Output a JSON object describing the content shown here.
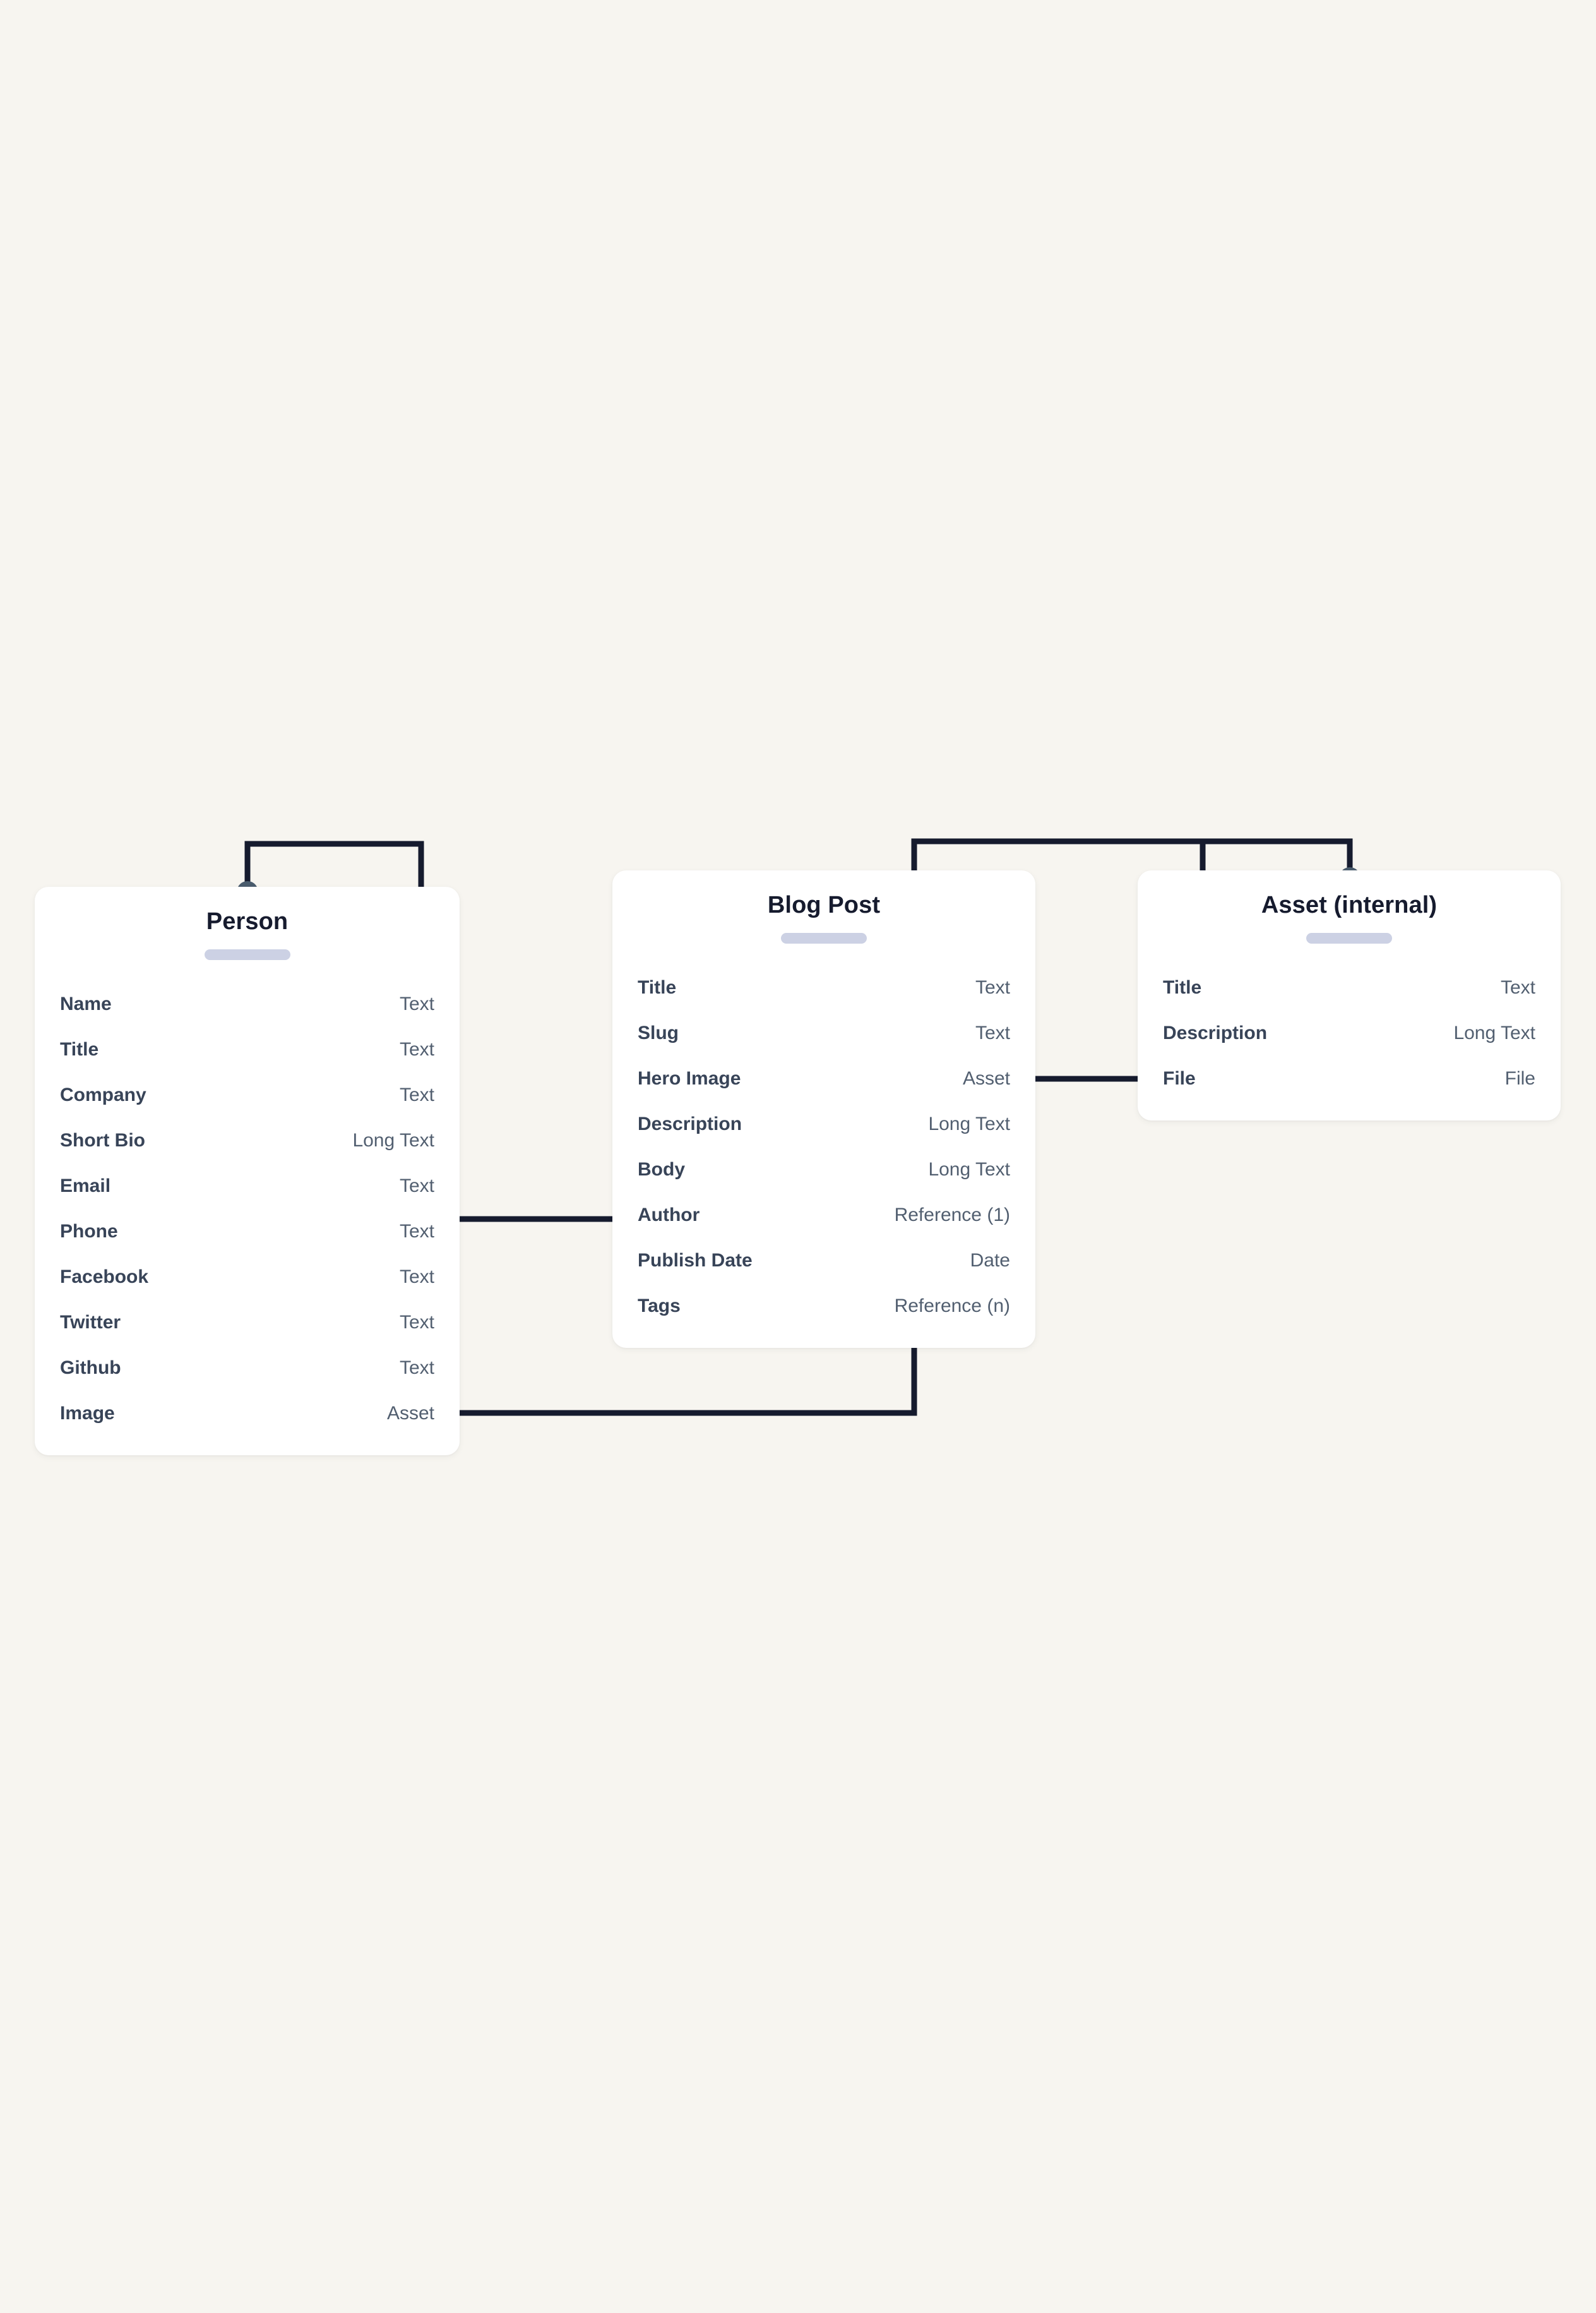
{
  "theme": {
    "background": "#f7f5f0",
    "card_background": "#ffffff",
    "title_color": "#161b2e",
    "label_color": "#384458",
    "type_color": "#525f70",
    "connector_color": "#161b2e",
    "dot_color": "#4a5c6d",
    "pill_color": "#ccd1e4"
  },
  "diagram": {
    "type": "content-model",
    "entities": [
      {
        "id": "person",
        "title": "Person",
        "fields": [
          {
            "name": "Name",
            "type": "Text"
          },
          {
            "name": "Title",
            "type": "Text"
          },
          {
            "name": "Company",
            "type": "Text"
          },
          {
            "name": "Short Bio",
            "type": "Long Text"
          },
          {
            "name": "Email",
            "type": "Text"
          },
          {
            "name": "Phone",
            "type": "Text"
          },
          {
            "name": "Facebook",
            "type": "Text"
          },
          {
            "name": "Twitter",
            "type": "Text"
          },
          {
            "name": "Github",
            "type": "Text"
          },
          {
            "name": "Image",
            "type": "Asset"
          }
        ]
      },
      {
        "id": "blogpost",
        "title": "Blog Post",
        "fields": [
          {
            "name": "Title",
            "type": "Text"
          },
          {
            "name": "Slug",
            "type": "Text"
          },
          {
            "name": "Hero Image",
            "type": "Asset"
          },
          {
            "name": "Description",
            "type": "Long Text"
          },
          {
            "name": "Body",
            "type": "Long Text"
          },
          {
            "name": "Author",
            "type": "Reference (1)"
          },
          {
            "name": "Publish Date",
            "type": "Date"
          },
          {
            "name": "Tags",
            "type": "Reference (n)"
          }
        ]
      },
      {
        "id": "asset",
        "title": "Asset (internal)",
        "fields": [
          {
            "name": "Title",
            "type": "Text"
          },
          {
            "name": "Description",
            "type": "Long Text"
          },
          {
            "name": "File",
            "type": "File"
          }
        ]
      }
    ],
    "relationships": [
      {
        "from": "blogpost.Author",
        "to": "person",
        "label": ""
      },
      {
        "from": "blogpost.Hero Image",
        "to": "asset",
        "label": ""
      },
      {
        "from": "person.Image",
        "to": "asset",
        "label": ""
      }
    ]
  }
}
